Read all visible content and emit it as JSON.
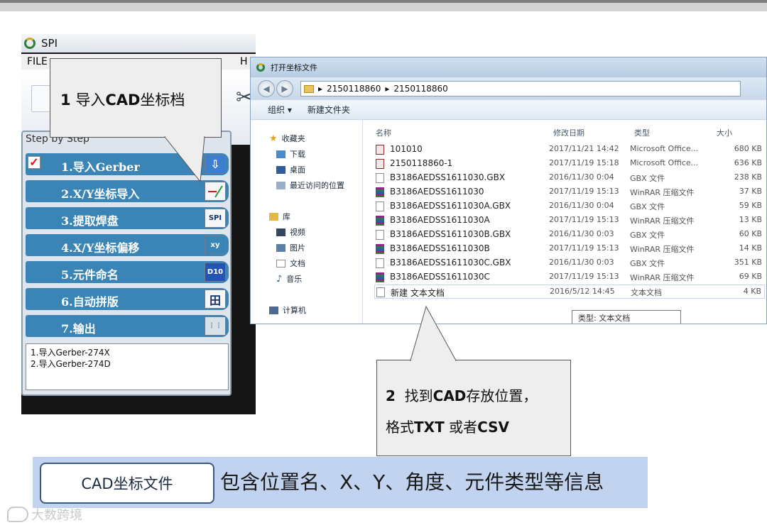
{
  "spi_window": {
    "title": "SPI",
    "menu_file": "FILE",
    "menu_last": "H",
    "panel_title": "Step by Step",
    "steps": [
      {
        "label": "1.导入Gerber",
        "icon": "arrow-down-icon",
        "checked": true
      },
      {
        "label": "2.X/Y坐标导入",
        "icon": "xy-import-icon"
      },
      {
        "label": "3.提取焊盘",
        "icon": "spi-icon",
        "btn_text": "SPI"
      },
      {
        "label": "4.X/Y坐标偏移",
        "icon": "xy-offset-icon",
        "btn_text": "xy"
      },
      {
        "label": "5.元件命名",
        "icon": "naming-icon",
        "btn_text": "D10"
      },
      {
        "label": "6.自动拼版",
        "icon": "grid-icon",
        "btn_text": "田"
      },
      {
        "label": "7.输出",
        "icon": "output-icon"
      }
    ],
    "info_lines": [
      "1.导入Gerber-274X",
      "2.导入Gerber-274D"
    ]
  },
  "callout1": {
    "num": "1",
    "text_pre": "导入",
    "text_bold": "CAD",
    "text_post": "坐标档"
  },
  "explorer": {
    "title": "打开坐标文件",
    "breadcrumb": [
      "2150118860",
      "2150118860"
    ],
    "toolbar": {
      "organize": "组织 ▾",
      "new_folder": "新建文件夹"
    },
    "sidebar": {
      "favorites": "收藏夹",
      "downloads": "下载",
      "desktop": "桌面",
      "recent": "最近访问的位置",
      "libraries": "库",
      "videos": "视频",
      "pictures": "图片",
      "documents": "文档",
      "music": "音乐",
      "computer": "计算机"
    },
    "columns": {
      "name": "名称",
      "date": "修改日期",
      "type": "类型",
      "size": "大小"
    },
    "files": [
      {
        "name": "101010",
        "date": "2017/11/21 14:42",
        "type": "Microsoft Office...",
        "size": "680 KB",
        "kind": "office"
      },
      {
        "name": "2150118860-1",
        "date": "2017/11/19 15:18",
        "type": "Microsoft Office...",
        "size": "636 KB",
        "kind": "office"
      },
      {
        "name": "B3186AEDSS1611030.GBX",
        "date": "2016/11/30 0:04",
        "type": "GBX 文件",
        "size": "238 KB",
        "kind": "file"
      },
      {
        "name": "B3186AEDSS1611030",
        "date": "2017/11/19 15:13",
        "type": "WinRAR 压缩文件",
        "size": "37 KB",
        "kind": "rar"
      },
      {
        "name": "B3186AEDSS1611030A.GBX",
        "date": "2016/11/30 0:04",
        "type": "GBX 文件",
        "size": "59 KB",
        "kind": "file"
      },
      {
        "name": "B3186AEDSS1611030A",
        "date": "2017/11/19 15:13",
        "type": "WinRAR 压缩文件",
        "size": "13 KB",
        "kind": "rar"
      },
      {
        "name": "B3186AEDSS1611030B.GBX",
        "date": "2016/11/30 0:03",
        "type": "GBX 文件",
        "size": "60 KB",
        "kind": "file"
      },
      {
        "name": "B3186AEDSS1611030B",
        "date": "2017/11/19 15:13",
        "type": "WinRAR 压缩文件",
        "size": "14 KB",
        "kind": "rar"
      },
      {
        "name": "B3186AEDSS1611030C.GBX",
        "date": "2016/11/30 0:03",
        "type": "GBX 文件",
        "size": "351 KB",
        "kind": "file"
      },
      {
        "name": "B3186AEDSS1611030C",
        "date": "2017/11/19 15:13",
        "type": "WinRAR 压缩文件",
        "size": "69 KB",
        "kind": "rar"
      },
      {
        "name": "新建 文本文档",
        "date": "2016/5/12 14:45",
        "type": "文本文档",
        "size": "4 KB",
        "kind": "file",
        "selected": true
      }
    ],
    "tooltip": "类型: 文本文档"
  },
  "callout2": {
    "num": "2",
    "l1_pre": "找到",
    "l1_bold": "CAD",
    "l1_post": "存放位置，",
    "l2_pre": "格式",
    "l2_bold1": "TXT",
    "l2_mid": " 或者",
    "l2_bold2": "CSV"
  },
  "banner": {
    "box_label": "CAD坐标文件",
    "text": "包含位置名、X、Y、角度、元件类型等信息"
  },
  "watermark": "大数跨境"
}
